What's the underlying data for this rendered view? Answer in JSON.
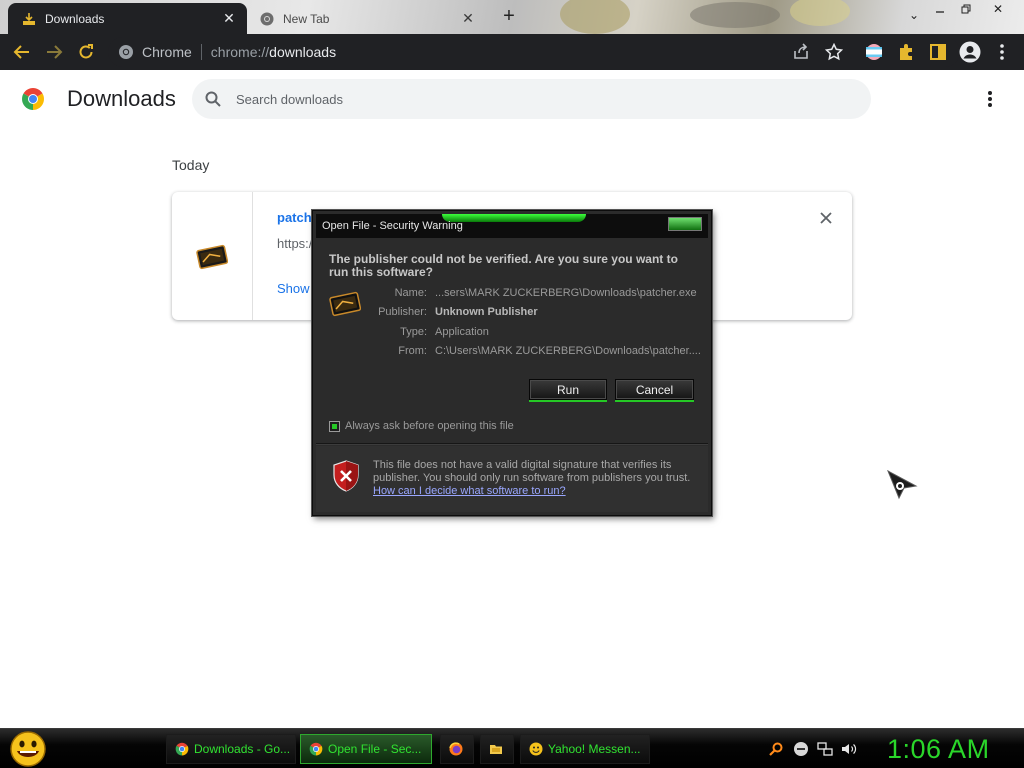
{
  "browser": {
    "tabs": [
      {
        "title": "Downloads",
        "active": true,
        "favicon": "download-tray-icon"
      },
      {
        "title": "New Tab",
        "active": false,
        "favicon": "chrome-icon"
      }
    ],
    "new_tab_symbol": "+",
    "window_controls": [
      "minimize-icon",
      "restore-icon",
      "close-icon"
    ],
    "omnibox": {
      "scheme_label": "Chrome",
      "url_prefix": "chrome://",
      "url_host": "downloads"
    },
    "toolbar_icons": [
      "back-icon",
      "forward-icon",
      "reload-icon",
      "share-icon",
      "star-icon",
      "profile-flag-icon",
      "extensions-icon",
      "sidepanel-icon",
      "avatar-icon",
      "menu-icon"
    ]
  },
  "downloads_page": {
    "title": "Downloads",
    "search_placeholder": "Search downloads",
    "section_label": "Today",
    "item": {
      "file_name": "patche",
      "url": "https:/",
      "action_label": "Show"
    }
  },
  "dialog": {
    "title": "Open File - Security Warning",
    "question": "The publisher could not be verified.  Are you sure you want to run this software?",
    "fields": [
      {
        "label": "Name:",
        "value": "...sers\\MARK ZUCKERBERG\\Downloads\\patcher.exe",
        "strong": false
      },
      {
        "label": "Publisher:",
        "value": "Unknown Publisher",
        "strong": true
      },
      {
        "label": "Type:",
        "value": "Application",
        "strong": false
      },
      {
        "label": "From:",
        "value": "C:\\Users\\MARK ZUCKERBERG\\Downloads\\patcher....",
        "strong": false
      }
    ],
    "run_label": "Run",
    "cancel_label": "Cancel",
    "checkbox_label": "Always ask before opening this file",
    "checkbox_checked": true,
    "warning_text": "This file does not have a valid digital signature that verifies its publisher.  You should only run software from publishers you trust.",
    "help_link": "How can I decide what software to run?"
  },
  "taskbar": {
    "tasks": [
      {
        "label": "Downloads - Go...",
        "icon": "chrome-icon",
        "active": false
      },
      {
        "label": "Open File - Sec...",
        "icon": "chrome-icon",
        "active": true
      },
      {
        "label": "",
        "icon": "firefox-icon",
        "active": false
      },
      {
        "label": "",
        "icon": "folder-icon",
        "active": false
      },
      {
        "label": "Yahoo! Messen...",
        "icon": "smiley-icon",
        "active": false
      }
    ],
    "tray_icons": [
      "search-icon",
      "minus-circle-icon",
      "network-icon",
      "volume-icon"
    ],
    "clock": "1:06 AM"
  },
  "colors": {
    "toolbar_bg": "#202124",
    "link_blue": "#1a73e8",
    "dialog_bg": "#2b2b2b",
    "accent_green": "#25c825",
    "clock_green": "#2ad62a"
  }
}
